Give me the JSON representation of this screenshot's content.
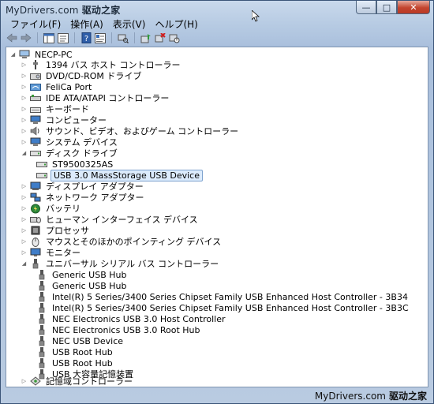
{
  "watermark": {
    "site": "MyDrivers.com",
    "cn": "驱动之家",
    "ghost": "ー"
  },
  "window_buttons": {
    "minimize": "—",
    "maximize": "□",
    "close": "✕"
  },
  "menu": [
    "ファイル(F)",
    "操作(A)",
    "表示(V)",
    "ヘルプ(H)"
  ],
  "tree": {
    "root": "NECP-PC",
    "nodes": [
      {
        "label": "1394 バス ホスト コントローラー",
        "icon": "firewire-icon",
        "state": "collapsed"
      },
      {
        "label": "DVD/CD-ROM ドライブ",
        "icon": "dvd-drive-icon",
        "state": "collapsed"
      },
      {
        "label": "FeliCa Port",
        "icon": "felica-icon",
        "state": "collapsed"
      },
      {
        "label": "IDE ATA/ATAPI コントローラー",
        "icon": "ide-controller-icon",
        "state": "collapsed"
      },
      {
        "label": "キーボード",
        "icon": "keyboard-icon",
        "state": "collapsed"
      },
      {
        "label": "コンピューター",
        "icon": "computer-icon",
        "state": "collapsed"
      },
      {
        "label": "サウンド、ビデオ、およびゲーム コントローラー",
        "icon": "sound-icon",
        "state": "collapsed"
      },
      {
        "label": "システム デバイス",
        "icon": "system-device-icon",
        "state": "collapsed"
      },
      {
        "label": "ディスク ドライブ",
        "icon": "disk-drive-icon",
        "state": "expanded",
        "children": [
          {
            "label": "ST9500325AS",
            "icon": "disk-icon"
          },
          {
            "label": "USB 3.0 MassStorage USB Device",
            "icon": "disk-icon",
            "selected": true
          }
        ]
      },
      {
        "label": "ディスプレイ アダプター",
        "icon": "display-adapter-icon",
        "state": "collapsed"
      },
      {
        "label": "ネットワーク アダプター",
        "icon": "network-adapter-icon",
        "state": "collapsed"
      },
      {
        "label": "バッテリ",
        "icon": "battery-icon",
        "state": "collapsed"
      },
      {
        "label": "ヒューマン インターフェイス デバイス",
        "icon": "hid-icon",
        "state": "collapsed"
      },
      {
        "label": "プロセッサ",
        "icon": "processor-icon",
        "state": "collapsed"
      },
      {
        "label": "マウスとそのほかのポインティング デバイス",
        "icon": "mouse-icon",
        "state": "collapsed"
      },
      {
        "label": "モニター",
        "icon": "monitor-icon",
        "state": "collapsed"
      },
      {
        "label": "ユニバーサル シリアル バス コントローラー",
        "icon": "usb-icon",
        "state": "expanded",
        "children": [
          {
            "label": "Generic USB Hub",
            "icon": "usb-icon"
          },
          {
            "label": "Generic USB Hub",
            "icon": "usb-icon"
          },
          {
            "label": "Intel(R) 5 Series/3400 Series Chipset Family USB Enhanced Host Controller - 3B34",
            "icon": "usb-icon"
          },
          {
            "label": "Intel(R) 5 Series/3400 Series Chipset Family USB Enhanced Host Controller - 3B3C",
            "icon": "usb-icon"
          },
          {
            "label": "NEC Electronics USB 3.0 Host Controller",
            "icon": "usb-icon"
          },
          {
            "label": "NEC Electronics USB 3.0 Root Hub",
            "icon": "usb-icon"
          },
          {
            "label": "NEC USB Device",
            "icon": "usb-icon"
          },
          {
            "label": "USB Root Hub",
            "icon": "usb-icon"
          },
          {
            "label": "USB Root Hub",
            "icon": "usb-icon"
          },
          {
            "label": "USB 大容量記憶装置",
            "icon": "usb-icon"
          }
        ]
      },
      {
        "label": "記憶域コントローラー",
        "icon": "storage-controller-icon",
        "state": "collapsed"
      }
    ]
  },
  "colors": {
    "selection": "#dcebfc",
    "selection_border": "#7da2ce",
    "window_frame": "#b7cbe3"
  }
}
